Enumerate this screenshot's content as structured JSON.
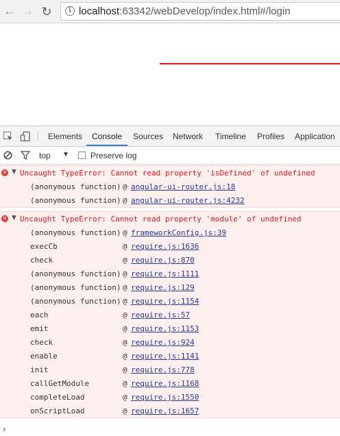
{
  "browser": {
    "url_host": "localhost",
    "url_rest": ":63342/webDevelop/index.html#/login"
  },
  "devtools": {
    "tabs": [
      "Elements",
      "Console",
      "Sources",
      "Network",
      "Timeline",
      "Profiles",
      "Application"
    ],
    "active_tab": "Console",
    "context": "top",
    "preserve_log_label": "Preserve log",
    "preserve_log_checked": false
  },
  "console": {
    "errors": [
      {
        "message": "Uncaught TypeError: Cannot read property 'isDefined' of undefined",
        "frames": [
          {
            "fn": "(anonymous function)",
            "at": "@",
            "loc": "angular-ui-router.js:18"
          },
          {
            "fn": "(anonymous function)",
            "at": "@",
            "loc": "angular-ui-router.js:4232"
          }
        ]
      },
      {
        "message": "Uncaught TypeError: Cannot read property 'module' of undefined",
        "frames": [
          {
            "fn": "(anonymous function)",
            "at": "@",
            "loc": "frameworkConfig.js:39"
          },
          {
            "fn": "execCb",
            "at": "@",
            "loc": "require.js:1636"
          },
          {
            "fn": "check",
            "at": "@",
            "loc": "require.js:870"
          },
          {
            "fn": "(anonymous function)",
            "at": "@",
            "loc": "require.js:1111"
          },
          {
            "fn": "(anonymous function)",
            "at": "@",
            "loc": "require.js:129"
          },
          {
            "fn": "(anonymous function)",
            "at": "@",
            "loc": "require.js:1154"
          },
          {
            "fn": "each",
            "at": "@",
            "loc": "require.js:57"
          },
          {
            "fn": "emit",
            "at": "@",
            "loc": "require.js:1153"
          },
          {
            "fn": "check",
            "at": "@",
            "loc": "require.js:924"
          },
          {
            "fn": "enable",
            "at": "@",
            "loc": "require.js:1141"
          },
          {
            "fn": "init",
            "at": "@",
            "loc": "require.js:778"
          },
          {
            "fn": "callGetModule",
            "at": "@",
            "loc": "require.js:1168"
          },
          {
            "fn": "completeLoad",
            "at": "@",
            "loc": "require.js:1550"
          },
          {
            "fn": "onScriptLoad",
            "at": "@",
            "loc": "require.js:1657"
          }
        ]
      }
    ],
    "prompt_symbol": "›"
  },
  "colors": {
    "error_text": "#e0181c",
    "error_bg": "#fff0f0",
    "link": "#1f3aa7",
    "tab_underline": "#3879d9",
    "page_line": "#d51818"
  }
}
